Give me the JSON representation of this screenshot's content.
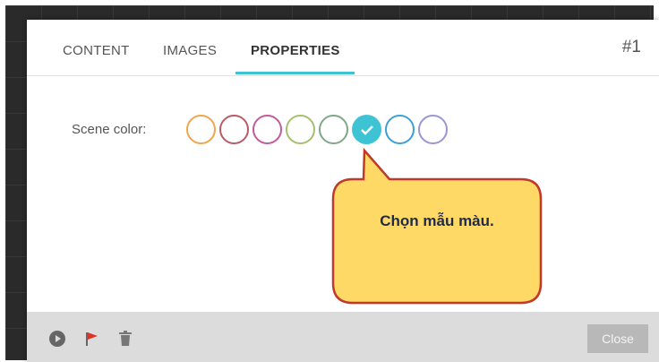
{
  "tabs": [
    {
      "label": "CONTENT",
      "active": false
    },
    {
      "label": "IMAGES",
      "active": false
    },
    {
      "label": "PROPERTIES",
      "active": true
    }
  ],
  "scene_number": "#1",
  "scene_color": {
    "label": "Scene color:",
    "swatches": [
      "#f0a64a",
      "#b85a6a",
      "#c25a9c",
      "#a6bf6e",
      "#7fa889",
      "#3ec3d5",
      "#3aa0d8",
      "#9a95d4"
    ],
    "selected_index": 5
  },
  "callout": {
    "text": "Chọn mẫu màu.",
    "fill": "#ffd966",
    "stroke": "#c0392b"
  },
  "footer": {
    "icons": [
      "play-icon",
      "flag-icon",
      "trash-icon"
    ],
    "close_label": "Close"
  },
  "colors": {
    "accent": "#3ec3d5"
  }
}
